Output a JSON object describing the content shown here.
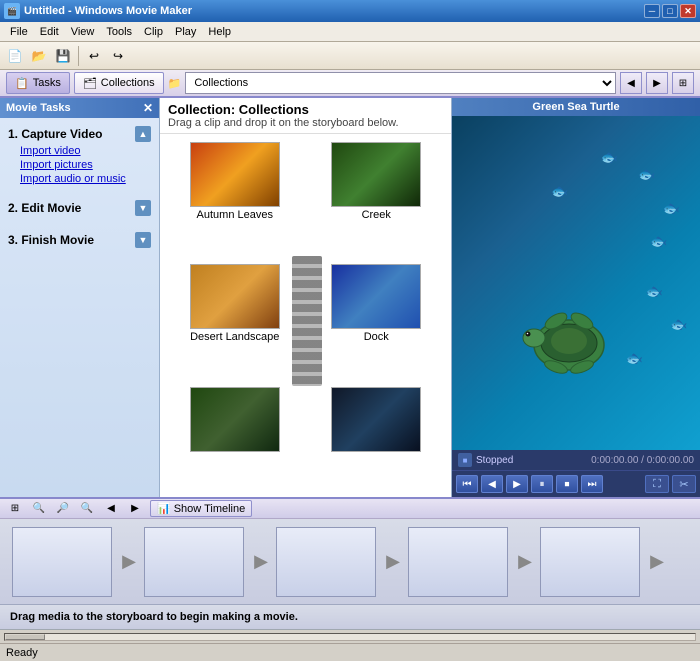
{
  "window": {
    "title": "Untitled - Windows Movie Maker",
    "icon": "🎬"
  },
  "titlebar": {
    "min": "─",
    "max": "□",
    "close": "✕"
  },
  "menu": {
    "items": [
      "File",
      "Edit",
      "View",
      "Tools",
      "Clip",
      "Play",
      "Help"
    ]
  },
  "toolbar": {
    "buttons": [
      "📄",
      "📂",
      "💾",
      "↩",
      "↪"
    ]
  },
  "viewtoolbar": {
    "tasks_label": "Tasks",
    "collections_label": "Collections",
    "collections_dropdown_label": "Collections",
    "collections_options": [
      "Collections"
    ]
  },
  "sidebar": {
    "header": "Movie Tasks",
    "sections": [
      {
        "title": "1. Capture Video",
        "links": [
          "Import video",
          "Import pictures",
          "Import audio or music"
        ]
      },
      {
        "title": "2. Edit Movie",
        "links": []
      },
      {
        "title": "3. Finish Movie",
        "links": []
      }
    ]
  },
  "collections": {
    "title": "Collection: Collections",
    "subtitle": "Drag a clip and drop it on the storyboard below.",
    "clips": [
      {
        "label": "Autumn Leaves",
        "theme": "autumn"
      },
      {
        "label": "Creek",
        "theme": "creek"
      },
      {
        "label": "Desert Landscape",
        "theme": "desert"
      },
      {
        "label": "Dock",
        "theme": "dock"
      },
      {
        "label": "",
        "theme": "row3a"
      },
      {
        "label": "",
        "theme": "row3b"
      }
    ]
  },
  "preview": {
    "title": "Green Sea Turtle",
    "status": "Stopped",
    "time": "0:00:00.00 / 0:00:00.00",
    "controls": [
      "⏮",
      "◀",
      "⏸",
      "▶",
      "⏭",
      "⏩"
    ]
  },
  "storyboard": {
    "show_timeline": "Show Timeline",
    "drag_message": "Drag media to the storyboard to begin making a movie."
  },
  "statusbar": {
    "text": "Ready"
  }
}
